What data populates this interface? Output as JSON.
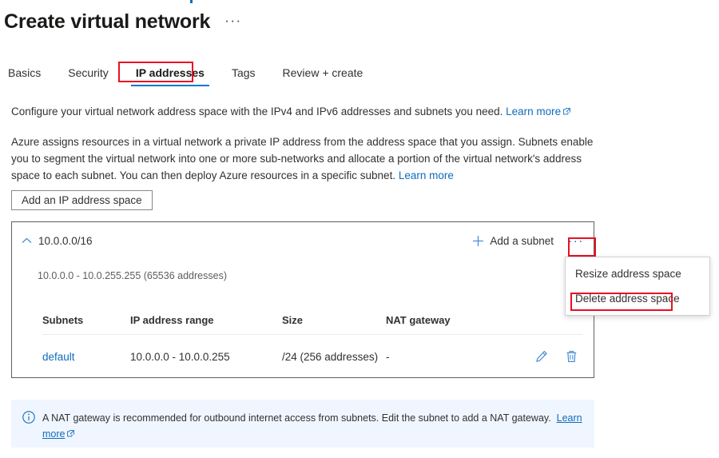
{
  "page": {
    "title": "Create virtual network",
    "title_overflow": "···"
  },
  "tabs": [
    {
      "label": "Basics",
      "selected": false
    },
    {
      "label": "Security",
      "selected": false
    },
    {
      "label": "IP addresses",
      "selected": true
    },
    {
      "label": "Tags",
      "selected": false
    },
    {
      "label": "Review + create",
      "selected": false
    }
  ],
  "description": {
    "paragraph1": "Configure your virtual network address space with the IPv4 and IPv6 addresses and subnets you need.",
    "paragraph1_link": "Learn more",
    "paragraph2": "Azure assigns resources in a virtual network a private IP address from the address space that you assign. Subnets enable you to segment the virtual network into one or more sub-networks and allocate a portion of the virtual network's address space to each subnet. You can then deploy Azure resources in a specific subnet.",
    "paragraph2_link": "Learn more"
  },
  "actions": {
    "add_ip_address_space": "Add an IP address space"
  },
  "address_space": {
    "cidr": "10.0.0.0/16",
    "range_summary": "10.0.0.0 - 10.0.255.255 (65536 addresses)",
    "add_subnet_label": "Add a subnet",
    "more_menu_label": "···",
    "collapse_icon": "chevron-up-icon"
  },
  "context_menu": {
    "items": [
      {
        "label": "Resize address space",
        "highlighted": false
      },
      {
        "label": "Delete address space",
        "highlighted": true
      }
    ]
  },
  "subnet_table": {
    "columns": [
      "Subnets",
      "IP address range",
      "Size",
      "NAT gateway"
    ],
    "rows": [
      {
        "subnet": "default",
        "ip_range": "10.0.0.0 - 10.0.0.255",
        "size": "/24 (256 addresses)",
        "nat_gateway": "-"
      }
    ]
  },
  "info_banner": {
    "text": "A NAT gateway is recommended for outbound internet access from subnets. Edit the subnet to add a NAT gateway.",
    "link": "Learn more"
  },
  "colors": {
    "accent": "#0078d4",
    "link": "#0f6cbd",
    "annotation": "#e81123",
    "banner_bg": "#f0f6ff",
    "panel_border": "#605e5c"
  }
}
